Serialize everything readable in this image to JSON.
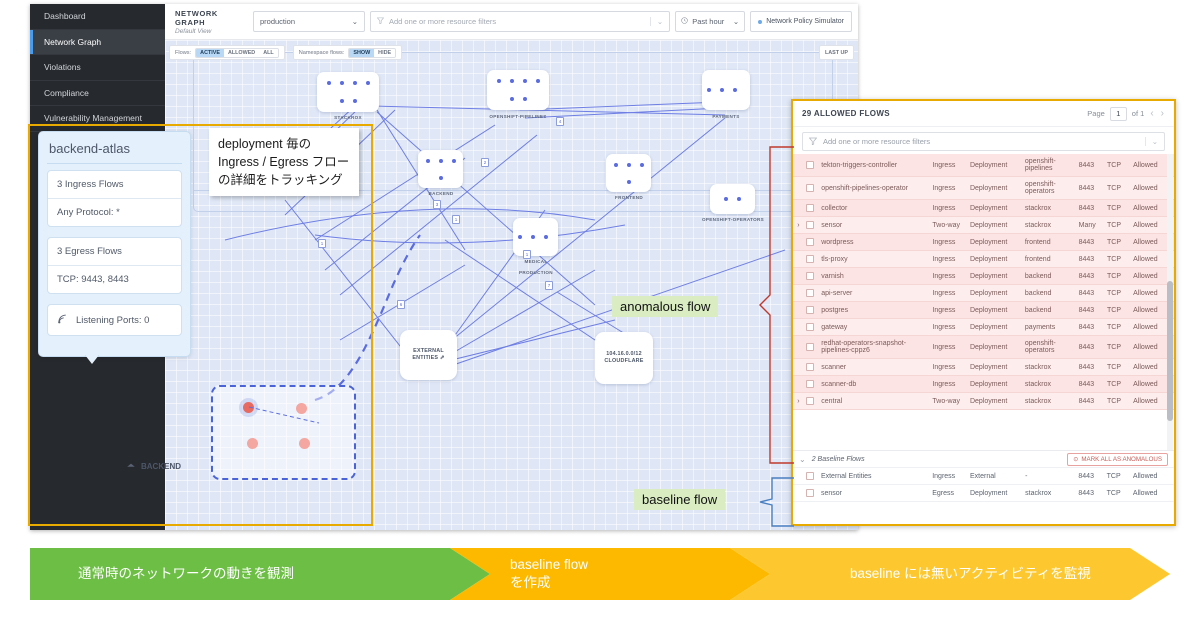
{
  "sidebar": {
    "items": [
      {
        "label": "Dashboard",
        "active": false
      },
      {
        "label": "Network Graph",
        "active": true
      },
      {
        "label": "Violations",
        "active": false
      },
      {
        "label": "Compliance",
        "active": false
      },
      {
        "label": "Vulnerability Management",
        "active": false
      }
    ]
  },
  "topbar": {
    "title": "NETWORK GRAPH",
    "subtitle": "Default View",
    "cluster_select": "production",
    "filter_placeholder": "Add one or more resource filters",
    "time_range": "Past hour",
    "simulator_button": "Network Policy Simulator"
  },
  "graph_toolbar": {
    "flows_label": "Flows:",
    "flows_options": [
      "ACTIVE",
      "ALLOWED",
      "ALL"
    ],
    "flows_selected": "ACTIVE",
    "namespace_label": "Namespace flows:",
    "namespace_options": [
      "SHOW",
      "HIDE"
    ],
    "namespace_selected": "SHOW",
    "last_updated": "LAST UP"
  },
  "graph": {
    "namespace_labels": [
      "MEDICAL",
      "PRODUCTION"
    ],
    "nodes": [
      {
        "label": "STACKROX",
        "dots": 6
      },
      {
        "label": "OPENSHIFT-PIPELINES",
        "dots": 6
      },
      {
        "label": "PAYMENTS",
        "dots": 3
      },
      {
        "label": "BACKEND",
        "dots": 4
      },
      {
        "label": "FRONTEND",
        "dots": 4
      },
      {
        "label": "OPENSHIFT-OPERATORS",
        "dots": 2
      },
      {
        "label": "MEDICAL",
        "dots": 3
      }
    ],
    "external_entities": "EXTERNAL\nENTITIES",
    "cloudflare_cidr": "104.16.0.0/12",
    "cloudflare_name": "CLOUDFLARE",
    "edge_badges": [
      "6",
      "4",
      "2",
      "3",
      "1",
      "1",
      "7",
      "1"
    ],
    "backend_cluster_label": "BACKEND"
  },
  "deployment_card": {
    "name": "backend-atlas",
    "ingress_flows": "3 Ingress Flows",
    "protocol": "Any Protocol: *",
    "egress_flows": "3 Egress Flows",
    "ports": "TCP: 9443, 8443",
    "listening_ports": "Listening Ports: 0"
  },
  "annotations": {
    "tooltip_jp": "deployment 毎の Ingress / Egress フローの詳細をトラッキング",
    "anomalous_flow": "anomalous flow",
    "baseline_flow": "baseline flow"
  },
  "flows_panel": {
    "title": "29 ALLOWED FLOWS",
    "page_label": "Page",
    "page_value": "1",
    "page_of": "of 1",
    "filter_placeholder": "Add one or more resource filters",
    "rows": [
      {
        "expand": "",
        "name": "tekton-triggers-controller",
        "direction": "Ingress",
        "type": "Deployment",
        "namespace": "openshift-pipelines",
        "port": "8443",
        "protocol": "TCP",
        "state": "Allowed"
      },
      {
        "expand": "",
        "name": "openshift-pipelines-operator",
        "direction": "Ingress",
        "type": "Deployment",
        "namespace": "openshift-operators",
        "port": "8443",
        "protocol": "TCP",
        "state": "Allowed"
      },
      {
        "expand": "",
        "name": "collector",
        "direction": "Ingress",
        "type": "Deployment",
        "namespace": "stackrox",
        "port": "8443",
        "protocol": "TCP",
        "state": "Allowed"
      },
      {
        "expand": "›",
        "name": "sensor",
        "direction": "Two-way",
        "type": "Deployment",
        "namespace": "stackrox",
        "port": "Many",
        "protocol": "TCP",
        "state": "Allowed"
      },
      {
        "expand": "",
        "name": "wordpress",
        "direction": "Ingress",
        "type": "Deployment",
        "namespace": "frontend",
        "port": "8443",
        "protocol": "TCP",
        "state": "Allowed"
      },
      {
        "expand": "",
        "name": "tls-proxy",
        "direction": "Ingress",
        "type": "Deployment",
        "namespace": "frontend",
        "port": "8443",
        "protocol": "TCP",
        "state": "Allowed"
      },
      {
        "expand": "",
        "name": "varnish",
        "direction": "Ingress",
        "type": "Deployment",
        "namespace": "backend",
        "port": "8443",
        "protocol": "TCP",
        "state": "Allowed"
      },
      {
        "expand": "",
        "name": "api-server",
        "direction": "Ingress",
        "type": "Deployment",
        "namespace": "backend",
        "port": "8443",
        "protocol": "TCP",
        "state": "Allowed"
      },
      {
        "expand": "",
        "name": "postgres",
        "direction": "Ingress",
        "type": "Deployment",
        "namespace": "backend",
        "port": "8443",
        "protocol": "TCP",
        "state": "Allowed"
      },
      {
        "expand": "",
        "name": "gateway",
        "direction": "Ingress",
        "type": "Deployment",
        "namespace": "payments",
        "port": "8443",
        "protocol": "TCP",
        "state": "Allowed"
      },
      {
        "expand": "",
        "name": "redhat-operators-snapshot-pipelines-cppz6",
        "direction": "Ingress",
        "type": "Deployment",
        "namespace": "openshift-operators",
        "port": "8443",
        "protocol": "TCP",
        "state": "Allowed"
      },
      {
        "expand": "",
        "name": "scanner",
        "direction": "Ingress",
        "type": "Deployment",
        "namespace": "stackrox",
        "port": "8443",
        "protocol": "TCP",
        "state": "Allowed"
      },
      {
        "expand": "",
        "name": "scanner-db",
        "direction": "Ingress",
        "type": "Deployment",
        "namespace": "stackrox",
        "port": "8443",
        "protocol": "TCP",
        "state": "Allowed"
      },
      {
        "expand": "›",
        "name": "central",
        "direction": "Two-way",
        "type": "Deployment",
        "namespace": "stackrox",
        "port": "8443",
        "protocol": "TCP",
        "state": "Allowed"
      }
    ],
    "baseline_title": "2 Baseline Flows",
    "mark_all_button": "MARK ALL AS ANOMALOUS",
    "baseline_rows": [
      {
        "name": "External Entities",
        "direction": "Ingress",
        "type": "External",
        "namespace": "-",
        "port": "8443",
        "protocol": "TCP",
        "state": "Allowed"
      },
      {
        "name": "sensor",
        "direction": "Egress",
        "type": "Deployment",
        "namespace": "stackrox",
        "port": "8443",
        "protocol": "TCP",
        "state": "Allowed"
      }
    ]
  },
  "process": {
    "steps": [
      {
        "label": "通常時のネットワークの動きを観測",
        "color": "#6cbe45"
      },
      {
        "label": "baseline flow を作成",
        "color": "#fcb900"
      },
      {
        "label": "baseline には無いアクティビティを監視",
        "color": "#fdc82f"
      }
    ],
    "step2_line1": "baseline flow",
    "step2_line2": "を作成"
  },
  "colors": {
    "accent_yellow": "#e8a900",
    "anomalous_red": "#c0392b",
    "baseline_blue": "#4a7fc1",
    "callout_green": "#d9ecc2"
  }
}
